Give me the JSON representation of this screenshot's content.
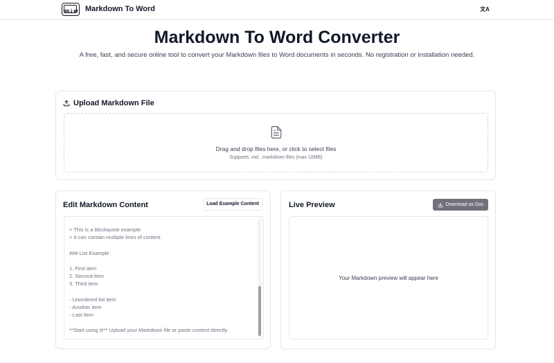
{
  "header": {
    "logo_text": "m↓w",
    "brand": "Markdown To Word",
    "lang_icon": "文A"
  },
  "hero": {
    "title": "Markdown To Word Converter",
    "subtitle": "A free, fast, and secure online tool to convert your Markdown files to Word documents in seconds. No registration or installation needed."
  },
  "upload": {
    "heading": "Upload Markdown File",
    "drop_text": "Drag and drop files here, or click to select files",
    "drop_hint": "Supports .md, .markdown files (max 10MB)"
  },
  "editor": {
    "heading": "Edit Markdown Content",
    "example_button": "Load Example Content",
    "lines": [
      "> This is a blockquote example",
      "> It can contain multiple lines of content",
      "",
      "### List Example",
      "",
      "1. First item",
      "2. Second item",
      "3. Third item",
      "",
      "- Unordered list item",
      "- Another item",
      "- Last item",
      "",
      "**Start using it!** Upload your Markdown file or paste content directly."
    ]
  },
  "preview": {
    "heading": "Live Preview",
    "download_button": "Download as Doc",
    "empty_text": "Your Markdown preview will appear here"
  },
  "icons": {
    "upload": "upload-icon",
    "file": "file-text-icon",
    "download": "download-icon",
    "language": "language-icon"
  }
}
